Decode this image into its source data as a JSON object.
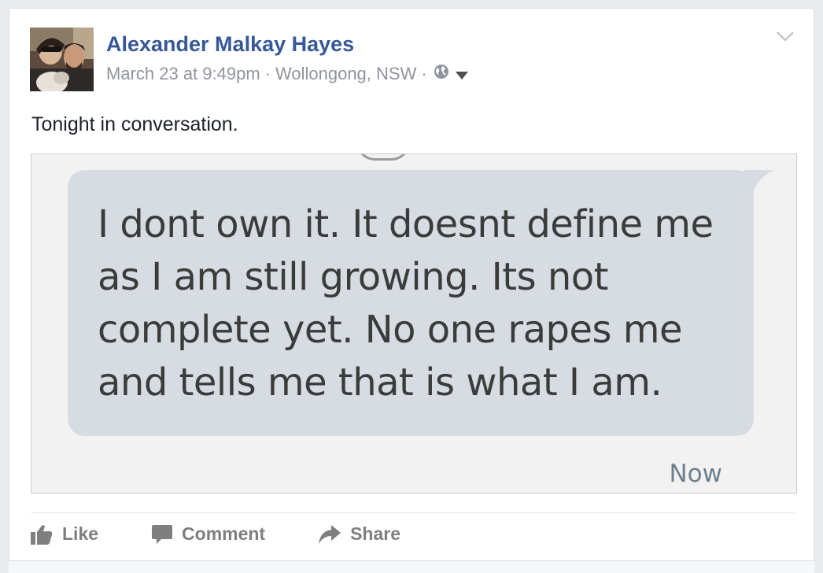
{
  "post": {
    "author": "Alexander Malkay Hayes",
    "date": "March 23 at 9:49pm",
    "separator": "·",
    "location": "Wollongong, NSW",
    "privacy_icon": "globe-icon",
    "caption": "Tonight in conversation."
  },
  "photo": {
    "message": "I dont own it. It doesnt define me as I am still growing. Its not complete yet. No one rapes me and tells me that is what I am.",
    "timestamp": "Now",
    "bubble_color": "#d6dce2"
  },
  "actions": {
    "like": "Like",
    "comment": "Comment",
    "share": "Share"
  },
  "colors": {
    "author_link": "#365899",
    "meta_text": "#90949c",
    "action_text": "#7f7f7f"
  }
}
